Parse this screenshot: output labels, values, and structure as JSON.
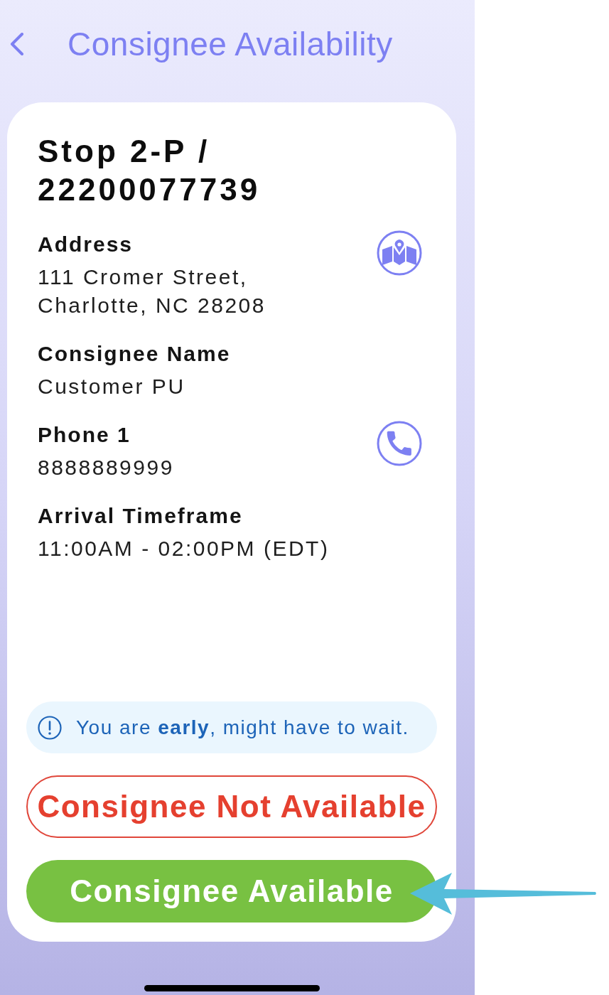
{
  "header": {
    "title": "Consignee Availability"
  },
  "stop": {
    "title": "Stop 2-P / 22200077739"
  },
  "fields": [
    {
      "label": "Address",
      "value": "111 Cromer Street, Charlotte, NC 28208",
      "kind": "map"
    },
    {
      "label": "Consignee Name",
      "value": "Customer PU",
      "kind": "plain"
    },
    {
      "label": "Phone 1",
      "value": "8888889999",
      "kind": "phone"
    },
    {
      "label": "Arrival Timeframe",
      "value": "11:00AM - 02:00PM (EDT)",
      "kind": "plain"
    }
  ],
  "notice": {
    "text": "You are **early**, might have to wait."
  },
  "buttons": [
    {
      "label": "Consignee Not Available",
      "kind": "outline"
    },
    {
      "label": "Consignee Available",
      "kind": "filled"
    }
  ]
}
